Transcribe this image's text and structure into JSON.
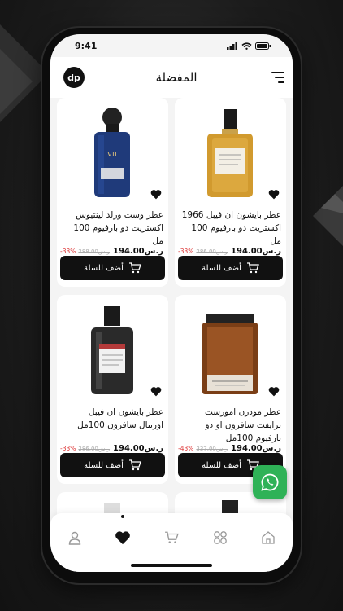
{
  "status_bar": {
    "time": "9:41"
  },
  "header": {
    "title": "المفضلة",
    "logo_text": "dp"
  },
  "products": [
    {
      "name": "عطر بايشون ان فيبل 1966 اكستريت دو بارفيوم 100 مل",
      "price": "194.00ر.س",
      "old_price": "286.00ر.س",
      "discount": "-33%",
      "cart_label": "أضف للسلة",
      "bottle": "amber"
    },
    {
      "name": "عطر وست ورلد لينتيوس اكستريت دو بارفيوم 100 مل",
      "price": "194.00ر.س",
      "old_price": "288.00ر.س",
      "discount": "-33%",
      "cart_label": "أضف للسلة",
      "bottle": "navy"
    },
    {
      "name": "عطر مودرن امورست  برايفت سافرون او دو بارفيوم 100مل",
      "price": "194.00ر.س",
      "old_price": "337.00ر.س",
      "discount": "-43%",
      "cart_label": "أضف للسلة",
      "bottle": "brown"
    },
    {
      "name": "عطر بايشون ان فيبل اورنتال سافرون 100مل",
      "price": "194.00ر.س",
      "old_price": "286.00ر.س",
      "discount": "-33%",
      "cart_label": "أضف للسلة",
      "bottle": "dark"
    }
  ],
  "colors": {
    "accent": "#111111",
    "discount": "#dd3333",
    "whatsapp": "#2fb257"
  },
  "nav": [
    "home-icon",
    "categories-icon",
    "cart-icon",
    "heart-icon",
    "user-icon"
  ]
}
